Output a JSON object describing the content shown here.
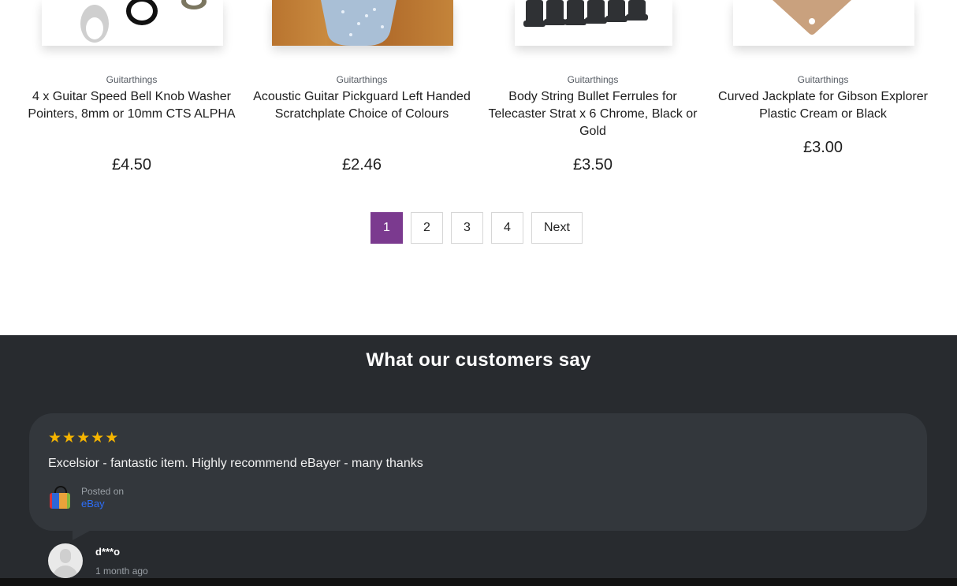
{
  "products": [
    {
      "vendor": "Guitarthings",
      "title": "4 x Guitar Speed Bell Knob Washer Pointers, 8mm or 10mm CTS ALPHA",
      "price": "£4.50",
      "image": "knob-washer-pointers-image"
    },
    {
      "vendor": "Guitarthings",
      "title": "Acoustic Guitar Pickguard Left Handed Scratchplate Choice of Colours",
      "price": "£2.46",
      "image": "pickguard-image"
    },
    {
      "vendor": "Guitarthings",
      "title": "Body String Bullet Ferrules for Telecaster Strat x 6 Chrome, Black or Gold",
      "price": "£3.50",
      "image": "string-ferrules-image"
    },
    {
      "vendor": "Guitarthings",
      "title": "Curved Jackplate for Gibson Explorer Plastic Cream or Black",
      "price": "£3.00",
      "image": "jackplate-image"
    }
  ],
  "pagination": {
    "pages": [
      "1",
      "2",
      "3",
      "4"
    ],
    "current": "1",
    "next_label": "Next"
  },
  "reviews": {
    "heading": "What our customers say",
    "items": [
      {
        "rating": 5,
        "rating_max": 5,
        "text": "Excelsior - fantastic item. Highly recommend eBayer - many thanks",
        "posted_on_label": "Posted on",
        "platform": "eBay",
        "author": "d***o",
        "time_ago": "1 month ago"
      }
    ]
  },
  "colors": {
    "accent": "#7b3a8f",
    "star": "#f5b400",
    "review_bg": "#282b2f",
    "bubble_bg": "#33373c",
    "link": "#2d6df6"
  }
}
